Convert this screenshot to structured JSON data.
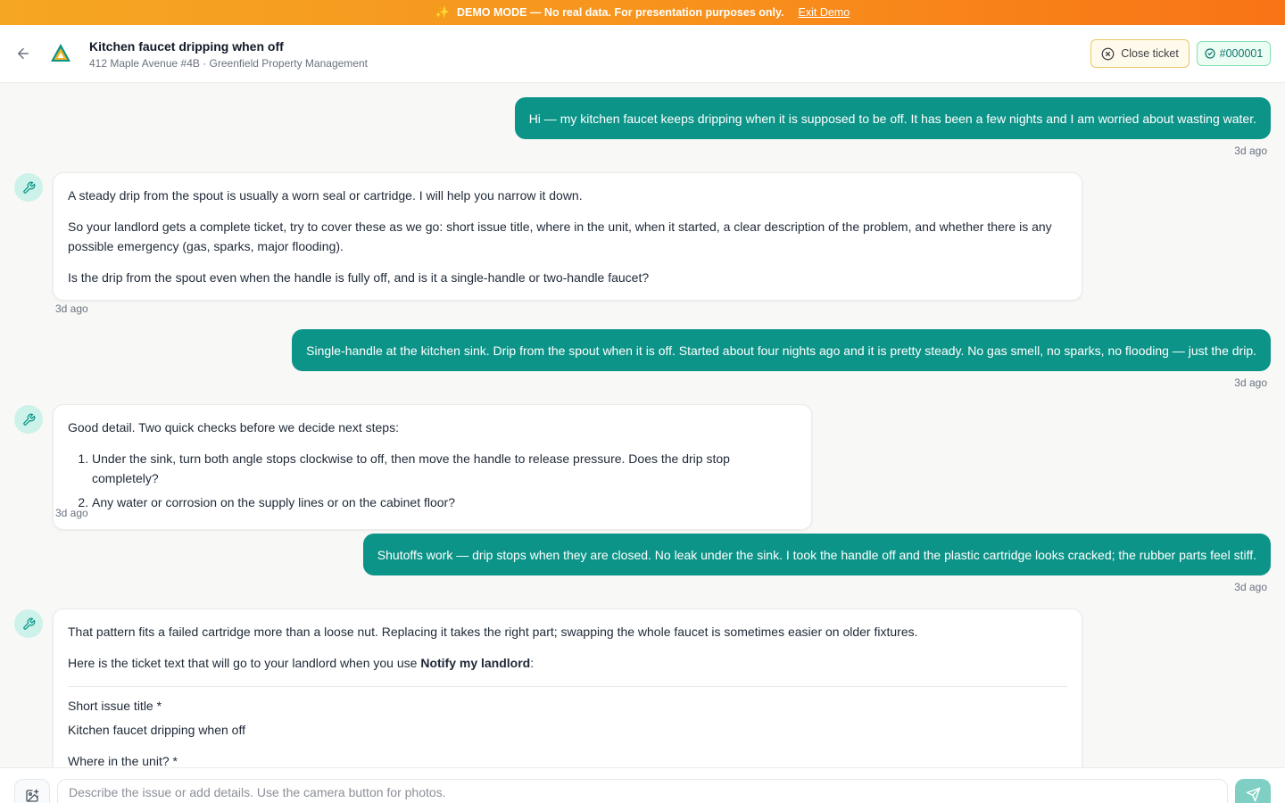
{
  "banner": {
    "text": "DEMO MODE — No real data. For presentation purposes only.",
    "exit_label": "Exit Demo"
  },
  "header": {
    "title": "Kitchen faucet dripping when off",
    "subtitle": "412 Maple Avenue #4B · Greenfield Property Management",
    "close_label": "Close ticket",
    "ticket_id": "#000001"
  },
  "messages": [
    {
      "role": "user",
      "text": "Hi — my kitchen faucet keeps dripping when it is supposed to be off. It has been a few nights and I am worried about wasting water.",
      "time": "3d ago"
    },
    {
      "role": "assistant",
      "paragraphs": [
        "A steady drip from the spout is usually a worn seal or cartridge. I will help you narrow it down.",
        "So your landlord gets a complete ticket, try to cover these as we go: short issue title, where in the unit, when it started, a clear description of the problem, and whether there is any possible emergency (gas, sparks, major flooding).",
        "Is the drip from the spout even when the handle is fully off, and is it a single-handle or two-handle faucet?"
      ],
      "time": "3d ago"
    },
    {
      "role": "user",
      "text": "Single-handle at the kitchen sink. Drip from the spout when it is off. Started about four nights ago and it is pretty steady. No gas smell, no sparks, no flooding — just the drip.",
      "time": "3d ago"
    },
    {
      "role": "assistant",
      "intro": "Good detail. Two quick checks before we decide next steps:",
      "list": [
        "Under the sink, turn both angle stops clockwise to off, then move the handle to release pressure. Does the drip stop completely?",
        "Any water or corrosion on the supply lines or on the cabinet floor?"
      ],
      "time": "3d ago"
    },
    {
      "role": "user",
      "text": "Shutoffs work — drip stops when they are closed. No leak under the sink. I took the handle off and the plastic cartridge looks cracked; the rubber parts feel stiff.",
      "time": "3d ago"
    },
    {
      "role": "assistant",
      "p1": "That pattern fits a failed cartridge more than a loose nut. Replacing it takes the right part; swapping the whole faucet is sometimes easier on older fixtures.",
      "p2_before": "Here is the ticket text that will go to your landlord when you use ",
      "p2_bold": "Notify my landlord",
      "p2_after": ":",
      "fields": [
        {
          "label": "Short issue title *",
          "value": "Kitchen faucet dripping when off"
        },
        {
          "label": "Where in the unit? *",
          "value": ""
        }
      ]
    }
  ],
  "composer": {
    "placeholder": "Describe the issue or add details. Use the camera button for photos."
  },
  "colors": {
    "accent": "#0d9488",
    "banner_start": "#f5a623",
    "banner_end": "#f97316",
    "send_disabled": "#7fcfc4"
  },
  "icons": {
    "banner": "sparkles-icon",
    "back": "arrow-left-icon",
    "logo": "triangle-logo",
    "close": "x-circle-icon",
    "ticket": "check-circle-icon",
    "assistant": "wrench-icon",
    "camera": "image-plus-icon",
    "send": "send-icon"
  }
}
